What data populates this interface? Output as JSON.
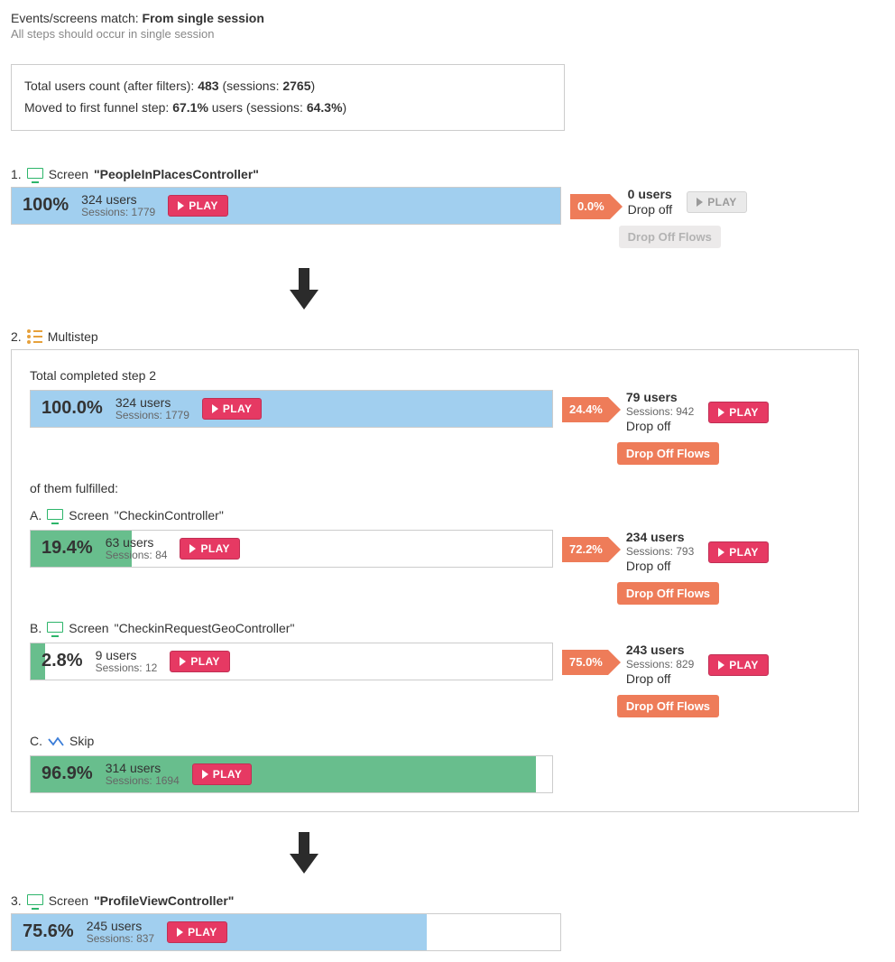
{
  "header": {
    "label": "Events/screens match:",
    "mode": "From single session",
    "sub": "All steps should occur in single session"
  },
  "summary": {
    "total_label": "Total users count (after filters):",
    "total_users": "483",
    "sessions_label": "(sessions:",
    "total_sessions": "2765",
    "close_paren": ")",
    "moved_label": "Moved to first funnel step:",
    "moved_users_pct": "67.1%",
    "users_word": "users",
    "moved_sessions_pct": "64.3%"
  },
  "labels": {
    "screen": "Screen",
    "multistep": "Multistep",
    "skip": "Skip",
    "play": "PLAY",
    "dropoff": "Drop off",
    "dropoff_flows": "Drop Off Flows"
  },
  "step1": {
    "index": "1.",
    "name": "\"PeopleInPlacesController\"",
    "pct": "100%",
    "users": "324 users",
    "sessions": "Sessions: 1779",
    "drop_pct": "0.0%",
    "drop_users": "0 users"
  },
  "step2": {
    "index": "2.",
    "total_label": "Total completed step 2",
    "pct": "100.0%",
    "users": "324 users",
    "sessions": "Sessions: 1779",
    "drop_pct": "24.4%",
    "drop_users": "79 users",
    "drop_sessions": "Sessions: 942",
    "fulfilled_label": "of them fulfilled:",
    "A": {
      "index": "A.",
      "name": "\"CheckinController\"",
      "pct": "19.4%",
      "users": "63 users",
      "sessions": "Sessions: 84",
      "drop_pct": "72.2%",
      "drop_users": "234 users",
      "drop_sessions": "Sessions: 793"
    },
    "B": {
      "index": "B.",
      "name": "\"CheckinRequestGeoController\"",
      "pct": "2.8%",
      "users": "9 users",
      "sessions": "Sessions: 12",
      "drop_pct": "75.0%",
      "drop_users": "243 users",
      "drop_sessions": "Sessions: 829"
    },
    "C": {
      "index": "C.",
      "pct": "96.9%",
      "users": "314 users",
      "sessions": "Sessions: 1694"
    }
  },
  "step3": {
    "index": "3.",
    "name": "\"ProfileViewController\"",
    "pct": "75.6%",
    "users": "245 users",
    "sessions": "Sessions: 837"
  }
}
